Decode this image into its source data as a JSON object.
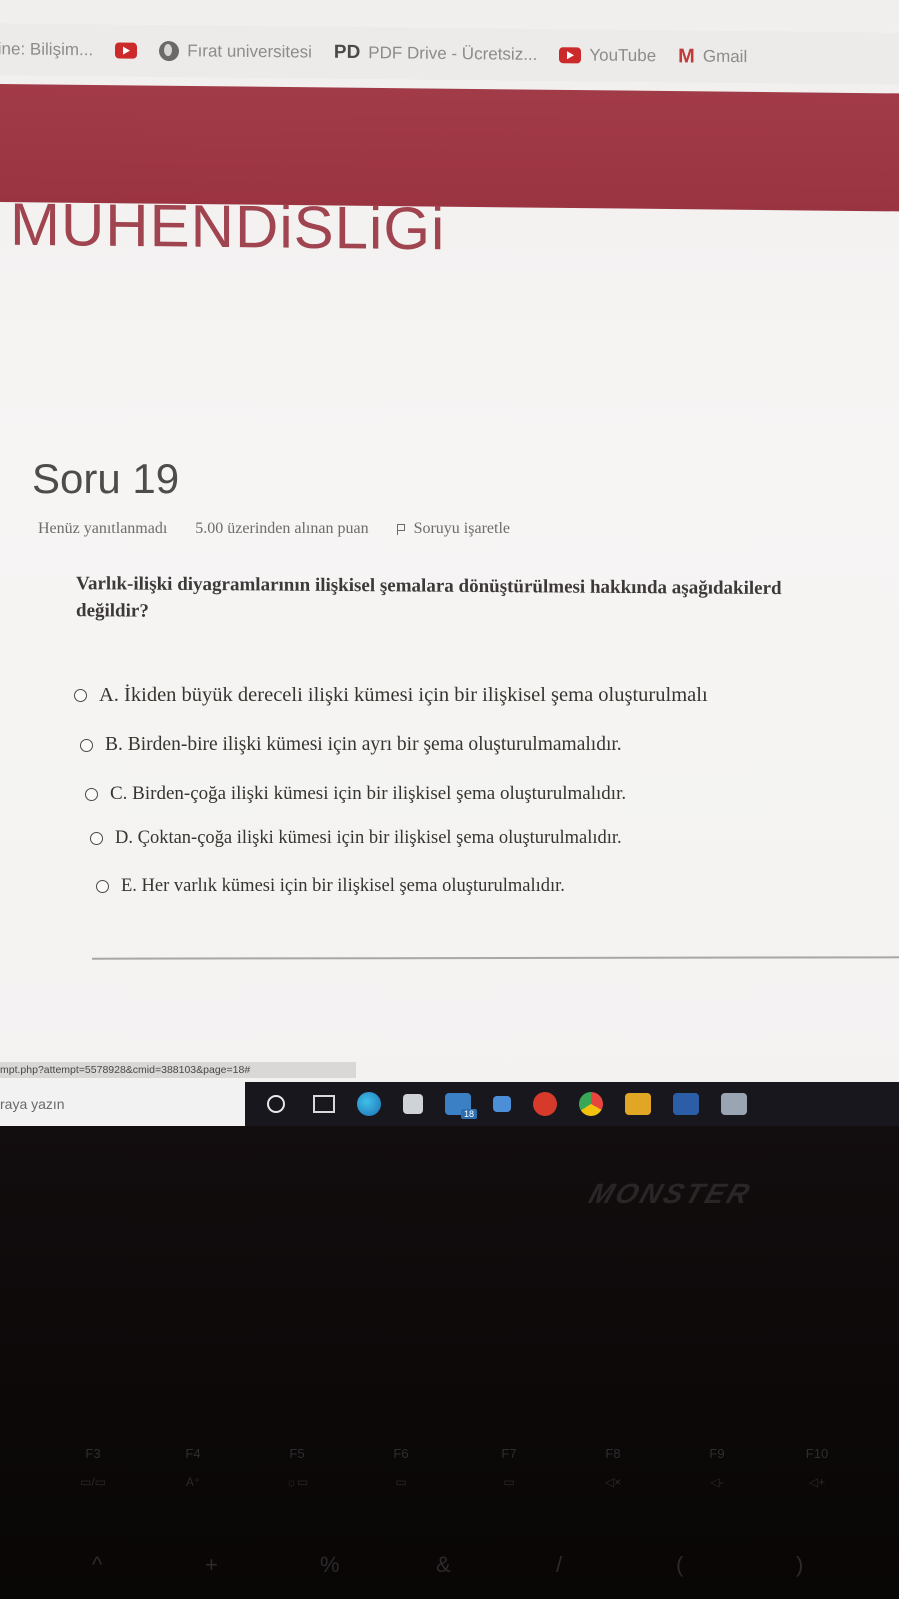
{
  "bookmarks": [
    {
      "label": "line: Bilişim...",
      "icon": "text"
    },
    {
      "label": "",
      "icon": "youtube-icon"
    },
    {
      "label": "Fırat universitesi",
      "icon": "globe-icon"
    },
    {
      "label": "PDF Drive - Ücretsiz...",
      "icon": "pd-icon",
      "prefix": "PD"
    },
    {
      "label": "YouTube",
      "icon": "youtube-icon"
    },
    {
      "label": "Gmail",
      "icon": "gmail-icon",
      "prefix": "M"
    }
  ],
  "course": {
    "title": "MUHENDiSLiGi"
  },
  "question": {
    "heading": "Soru 19",
    "status": "Henüz yanıtlanmadı",
    "points": "5.00 üzerinden alınan puan",
    "flag_label": "Soruyu işaretle",
    "text_line1": "Varlık-ilişki diyagramlarının ilişkisel şemalara dönüştürülmesi hakkında aşağıdakilerd",
    "text_line2": "değildir?"
  },
  "answers": [
    {
      "label": "A. İkiden büyük dereceli ilişki kümesi için bir ilişkisel şema oluşturulmalı"
    },
    {
      "label": "B. Birden-bire ilişki kümesi için ayrı bir şema oluşturulmamalıdır."
    },
    {
      "label": "C. Birden-çoğa ilişki kümesi için bir ilişkisel şema oluşturulmalıdır."
    },
    {
      "label": "D. Çoktan-çoğa ilişki kümesi için bir ilişkisel şema oluşturulmalıdır."
    },
    {
      "label": "E. Her varlık kümesi için bir ilişkisel şema oluşturulmalıdır."
    }
  ],
  "status_bar": {
    "url": "mpt.php?attempt=5578928&cmid=388103&page=18#"
  },
  "taskbar": {
    "search_placeholder": "raya yazın",
    "mail_badge": "18"
  },
  "laptop": {
    "brand": "MONSTER",
    "fkeys": [
      {
        "label": "F3",
        "sub": "▭/▭"
      },
      {
        "label": "F4",
        "sub": "A⁺"
      },
      {
        "label": "F5",
        "sub": "☼▭"
      },
      {
        "label": "F6",
        "sub": "▭"
      },
      {
        "label": "F7",
        "sub": "▭"
      },
      {
        "label": "F8",
        "sub": "◁×"
      },
      {
        "label": "F9",
        "sub": "◁-"
      },
      {
        "label": "F10",
        "sub": "◁+"
      }
    ],
    "numkeys": [
      "^",
      "+",
      "%",
      "&",
      "/",
      "(",
      ")"
    ]
  },
  "colors": {
    "banner": "#a23b48",
    "title": "#a04450",
    "taskbar": "#17171d"
  }
}
